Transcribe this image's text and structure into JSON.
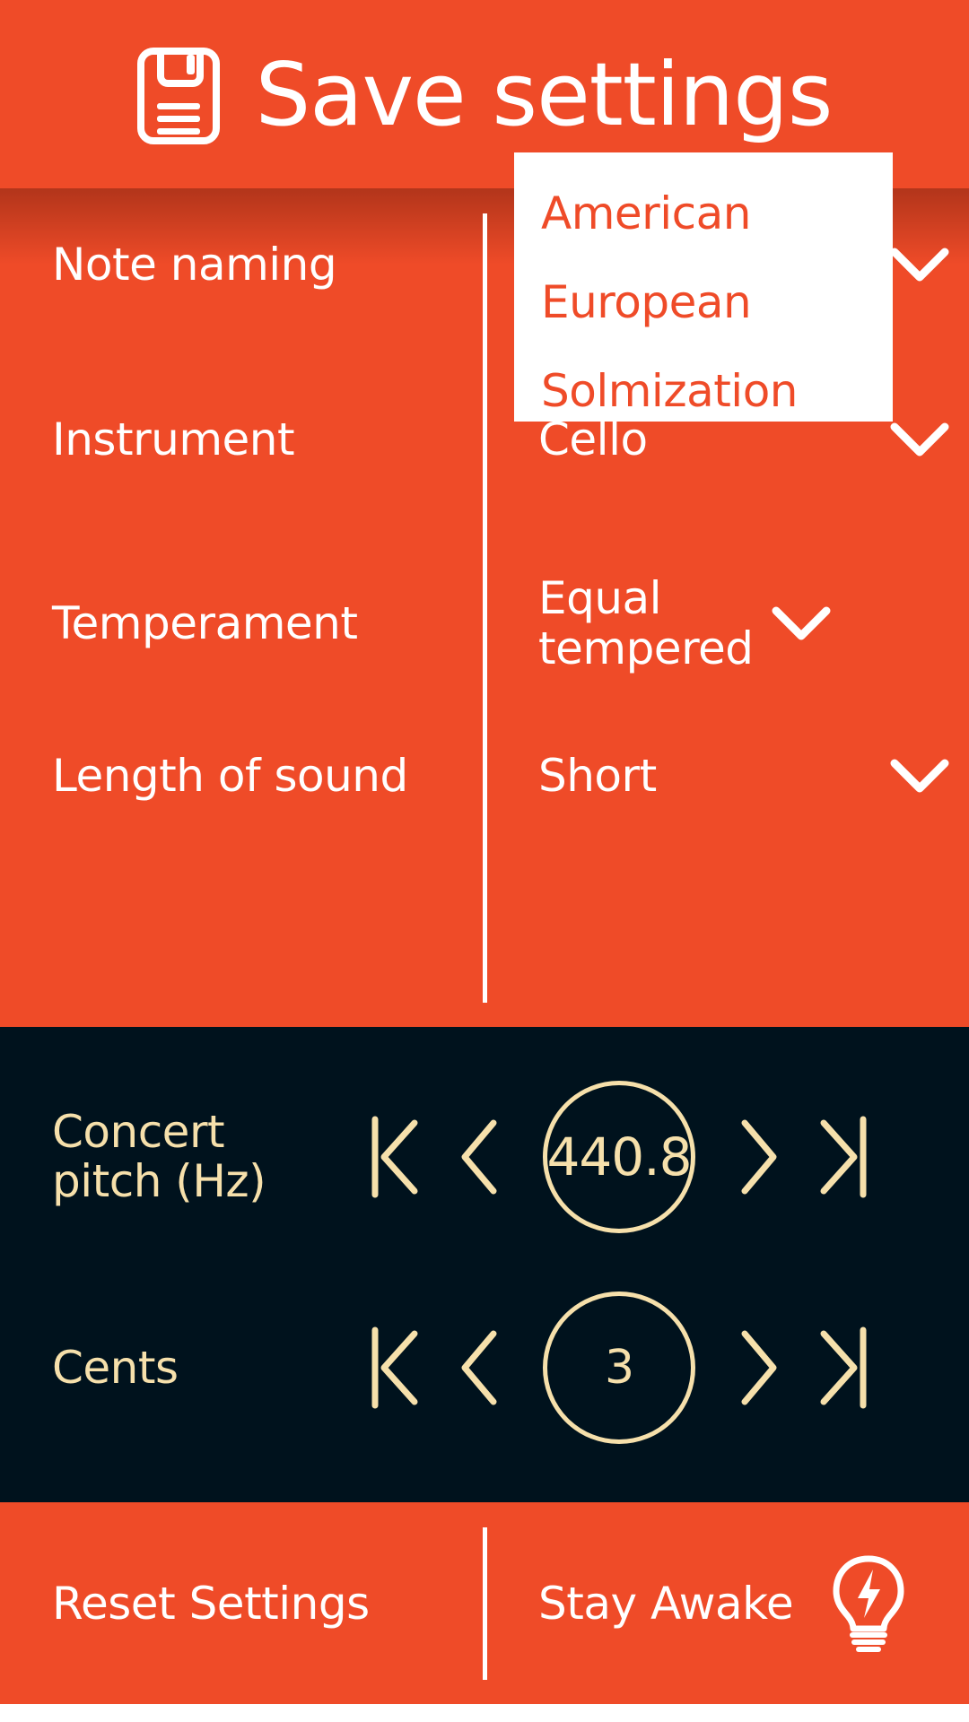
{
  "header": {
    "title": "Save settings",
    "icon": "floppy-disk-save-icon"
  },
  "settings": {
    "rows": [
      {
        "label": "Note naming",
        "value": "American",
        "chevron": "chevron-down-icon"
      },
      {
        "label": "Instrument",
        "value": "Cello",
        "chevron": "chevron-down-icon"
      },
      {
        "label": "Temperament",
        "value": "Equal tempered",
        "chevron": "chevron-down-icon"
      },
      {
        "label": "Length of sound",
        "value": "Short",
        "chevron": "chevron-down-icon"
      }
    ],
    "dropdown": {
      "open_for": "Note naming",
      "options": [
        "American",
        "European",
        "Solmization"
      ]
    }
  },
  "numeric": {
    "rows": [
      {
        "label": "Concert pitch (Hz)",
        "value": "440.8",
        "first_icon": "skip-to-first-icon",
        "prev_icon": "chevron-left-icon",
        "next_icon": "chevron-right-icon",
        "last_icon": "skip-to-last-icon"
      },
      {
        "label": "Cents",
        "value": "3",
        "first_icon": "skip-to-first-icon",
        "prev_icon": "chevron-left-icon",
        "next_icon": "chevron-right-icon",
        "last_icon": "skip-to-last-icon"
      }
    ]
  },
  "footer": {
    "reset_label": "Reset Settings",
    "stay_awake_label": "Stay Awake",
    "stay_awake_icon": "lightbulb-bolt-icon"
  },
  "colors": {
    "orange": "#EF4B28",
    "dark": "#00121D",
    "cream": "#F6E0AB",
    "white": "#FFFFFF"
  }
}
